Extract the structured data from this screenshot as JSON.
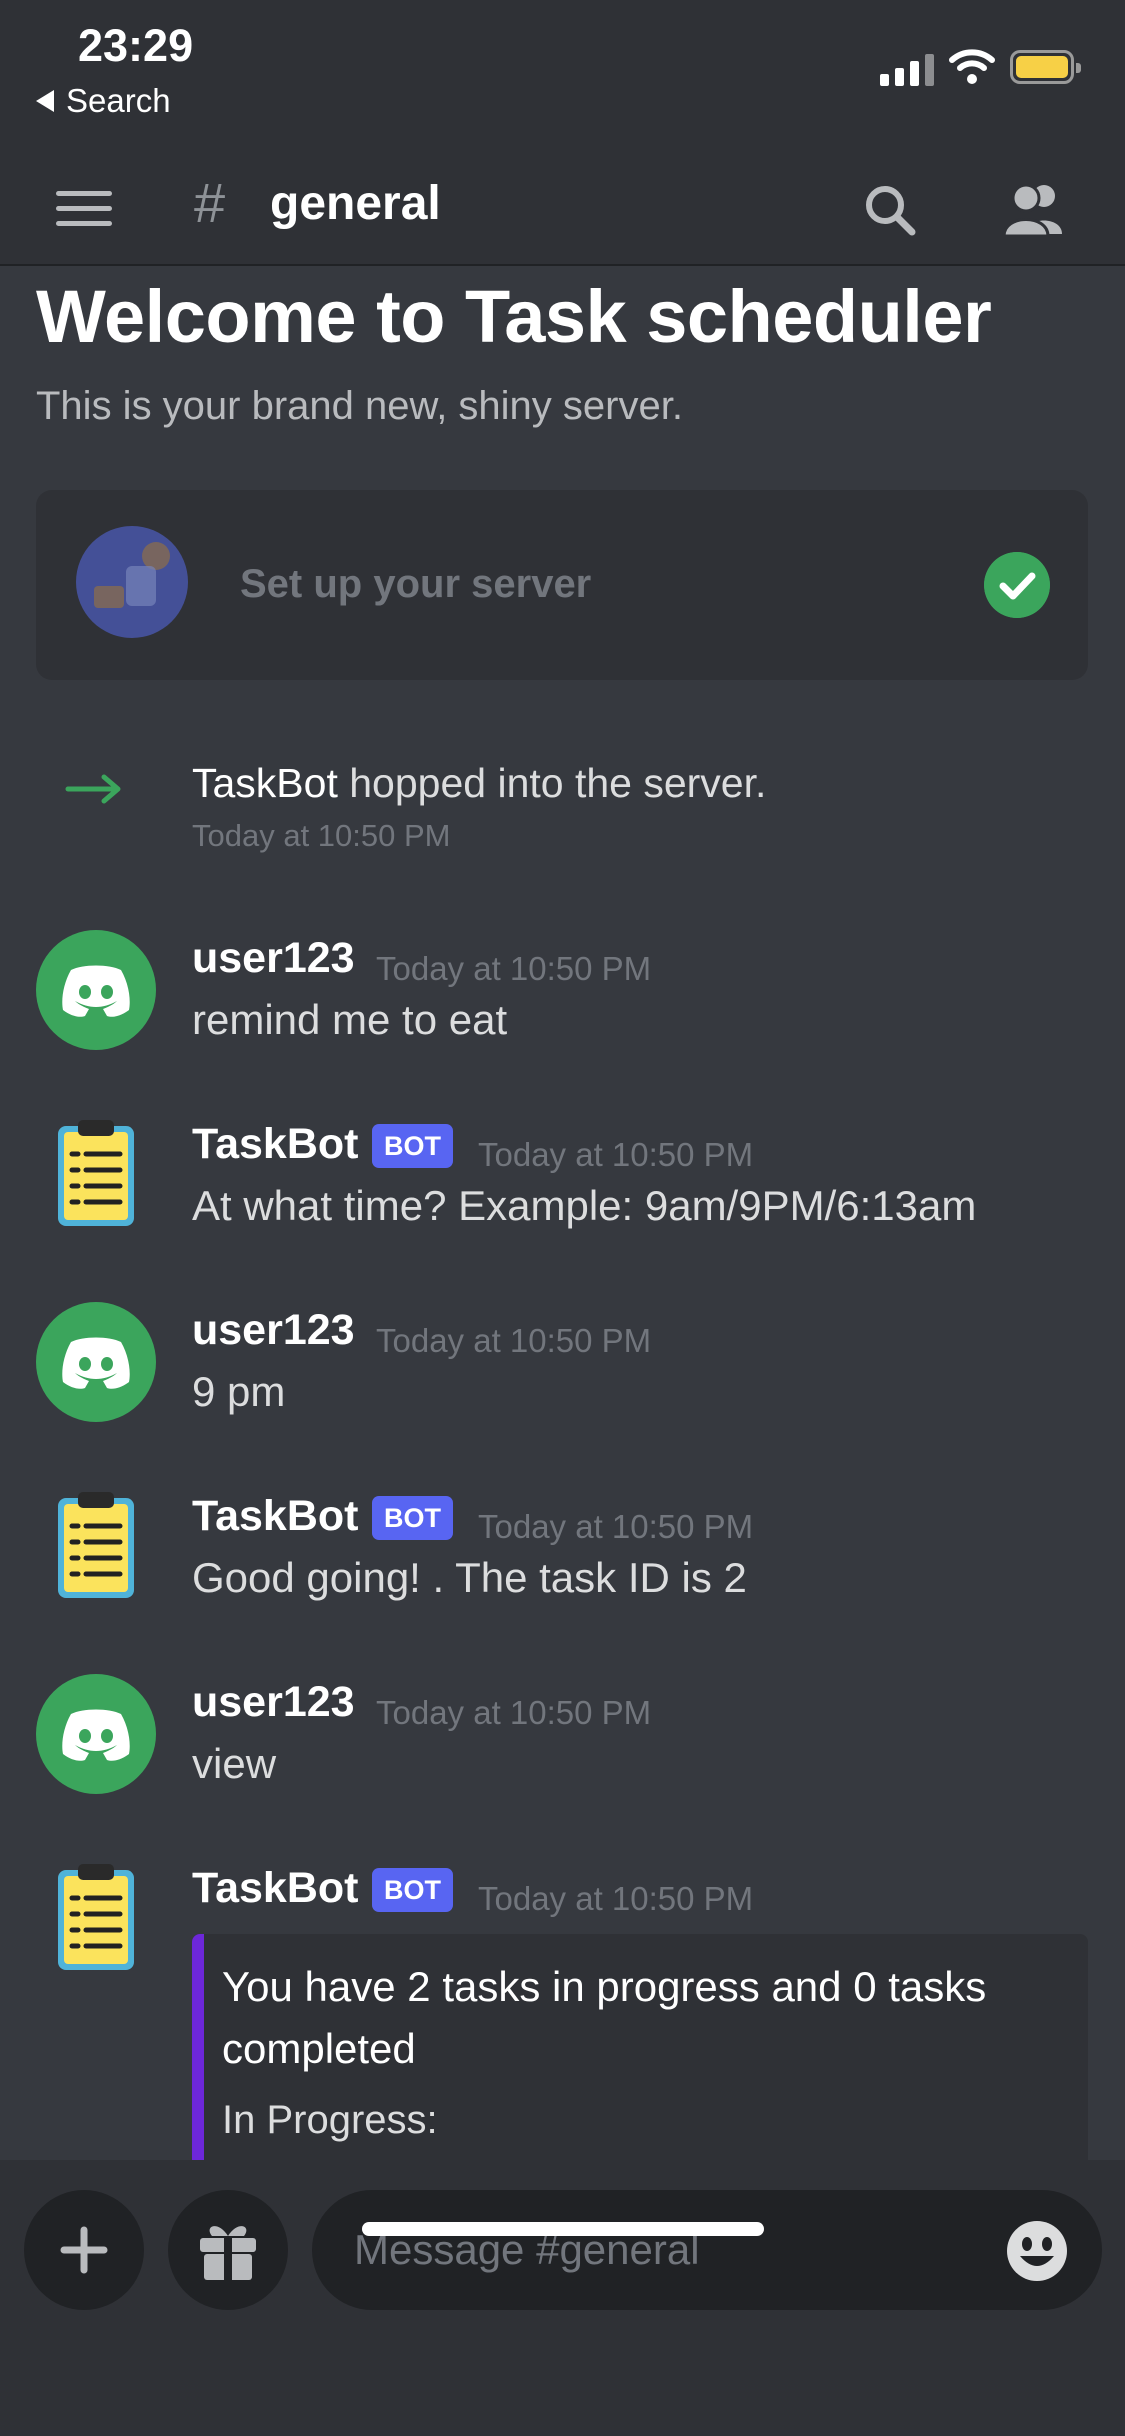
{
  "status_bar": {
    "time": "23:29",
    "back_label": "Search"
  },
  "header": {
    "channel_prefix": "#",
    "channel_name": "general"
  },
  "welcome": {
    "title": "Welcome to Task scheduler",
    "subtitle": "This is your brand new, shiny server.",
    "setup_card_label": "Set up your server"
  },
  "system_message": {
    "author": "TaskBot",
    "text": "hopped into the server.",
    "time": "Today at 10:50 PM"
  },
  "messages": [
    {
      "author": "user123",
      "time": "Today at 10:50 PM",
      "text": "remind me to eat"
    },
    {
      "author": "TaskBot",
      "badge": "BOT",
      "time": "Today at 10:50 PM",
      "text": "At what time? Example: 9am/9PM/6:13am"
    },
    {
      "author": "user123",
      "time": "Today at 10:50 PM",
      "text": "9 pm"
    },
    {
      "author": "TaskBot",
      "badge": "BOT",
      "time": "Today at 10:50 PM",
      "text": "Good going! . The task ID is 2"
    },
    {
      "author": "user123",
      "time": "Today at 10:50 PM",
      "text": "view"
    },
    {
      "author": "TaskBot",
      "badge": "BOT",
      "time": "Today at 10:50 PM",
      "embed": {
        "title": "You have 2 tasks in progress and 0 tasks completed",
        "subtitle": "In Progress:"
      }
    }
  ],
  "composer": {
    "placeholder": "Message #general"
  },
  "colors": {
    "background": "#36393f",
    "header": "#2f3136",
    "accent": "#5865f2",
    "online_green": "#3ba55c",
    "embed_bar": "#6d27d9"
  },
  "icons": [
    "hamburger-icon",
    "hash-icon",
    "search-icon",
    "members-icon",
    "discord-logo-icon",
    "clipboard-icon",
    "join-arrow-icon",
    "check-icon",
    "plus-icon",
    "gift-icon",
    "emoji-icon"
  ]
}
